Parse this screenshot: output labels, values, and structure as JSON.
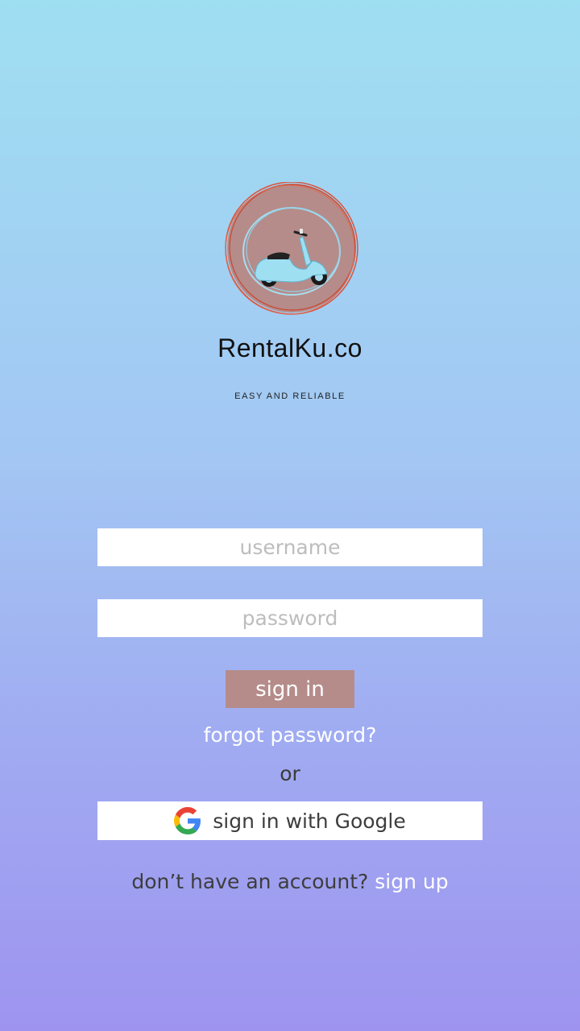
{
  "brand": {
    "name": "RentalKu.co",
    "tagline": "EASY AND RELIABLE",
    "logo_icon": "scooter-icon"
  },
  "form": {
    "username_placeholder": "username",
    "password_placeholder": "password",
    "signin_label": "sign in",
    "forgot_label": "forgot password?",
    "or_label": "or",
    "google_label": "sign in with Google",
    "signup_prompt": "don’t have an account?",
    "signup_link": "sign up"
  },
  "colors": {
    "gradient_top": "#9fdff2",
    "gradient_bottom": "#9e94f0",
    "signin_button": "#b58c8a",
    "logo_circle": "#b58c8a",
    "scooter": "#9fdff2"
  }
}
